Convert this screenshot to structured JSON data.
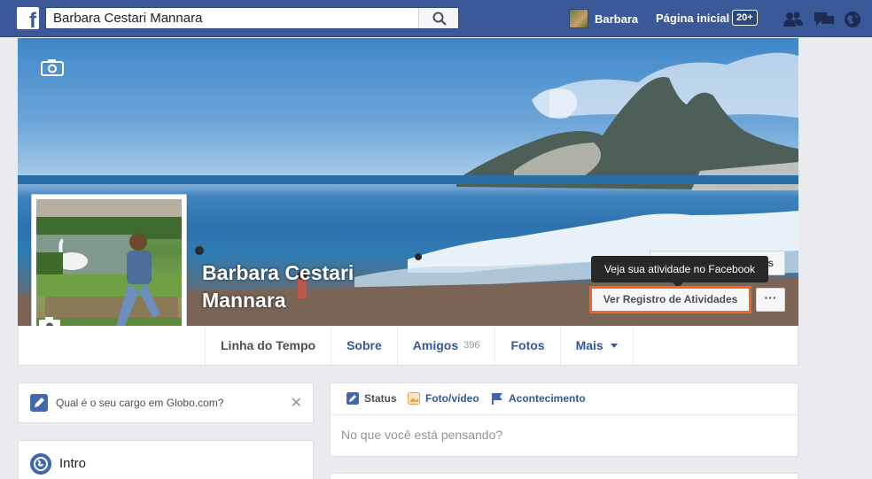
{
  "topbar": {
    "logo": "f",
    "search_value": "Barbara Cestari Mannara",
    "user_name": "Barbara",
    "home_label": "Página inicial",
    "notif_badge": "20+",
    "icons": [
      "friends-icon",
      "messages-icon",
      "globe-icon"
    ]
  },
  "profile": {
    "name": "Barbara Cestari Mannara"
  },
  "cover_actions": {
    "hidden_button_tail": "s",
    "tooltip": "Veja sua atividade no Facebook",
    "activity_button": "Ver Registro de Atividades",
    "more_button": "···"
  },
  "tabs": [
    {
      "label": "Linha do Tempo",
      "active": true
    },
    {
      "label": "Sobre"
    },
    {
      "label": "Amigos",
      "count": "396"
    },
    {
      "label": "Fotos"
    },
    {
      "label": "Mais"
    }
  ],
  "prompt": {
    "text": "Qual é o seu cargo em Globo.com?",
    "close": "✕"
  },
  "intro": {
    "title": "Intro"
  },
  "composer": {
    "tabs": [
      "Status",
      "Foto/vídeo",
      "Acontecimento"
    ],
    "placeholder": "No que você está pensando?"
  },
  "colors": {
    "brand": "#3b5998",
    "highlight": "#f26522",
    "link": "#365899"
  }
}
